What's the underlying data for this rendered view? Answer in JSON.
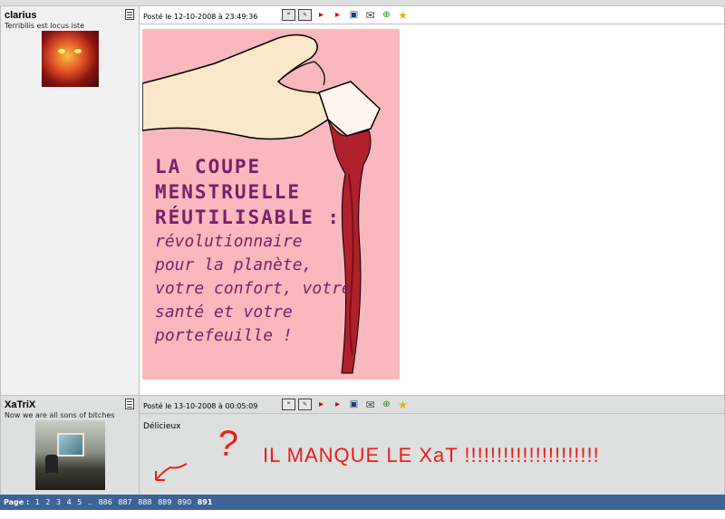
{
  "posts": [
    {
      "author": "clarius",
      "quote": "Terribilis est locus iste",
      "date": "Posté le 12-10-2008 à 23:49:36",
      "icons": [
        "profile-icon",
        "quote-icon",
        "edit-icon",
        "reply-icon",
        "delete-icon",
        "screen-icon",
        "mail-icon",
        "add-icon",
        "star-icon"
      ],
      "poster": {
        "heading": [
          "LA COUPE",
          "MENSTRUELLE",
          "RÉUTILISABLE :"
        ],
        "subtext": [
          "révolutionnaire",
          "pour la planète,",
          "votre confort, votre",
          "santé et votre",
          "portefeuille !"
        ]
      }
    },
    {
      "author": "XaTriX",
      "quote": "Now we are all sons of bitches",
      "date": "Posté le 13-10-2008 à 00:05:09",
      "body": "Délicieux",
      "icons": [
        "profile-icon",
        "quote-icon",
        "edit-icon",
        "reply-icon",
        "delete-icon",
        "screen-icon",
        "mail-icon",
        "add-icon",
        "star-icon"
      ]
    }
  ],
  "annotation": {
    "text": "IL MANQUE LE XaT !!!!!!!!!!!!!!!!!!!!!",
    "question": "?",
    "color": "#e8201a"
  },
  "pagination": {
    "label": "Page :",
    "pages": [
      "1",
      "2",
      "3",
      "4",
      "5",
      "..",
      "886",
      "887",
      "888",
      "889",
      "890"
    ],
    "current": "891"
  },
  "colors": {
    "pagebar": "#3c6496",
    "post_alt_bg": "#dedfdf",
    "poster_bg": "#f9b8bd",
    "poster_ink": "#7a1f6a",
    "blood": "#b0202a"
  }
}
